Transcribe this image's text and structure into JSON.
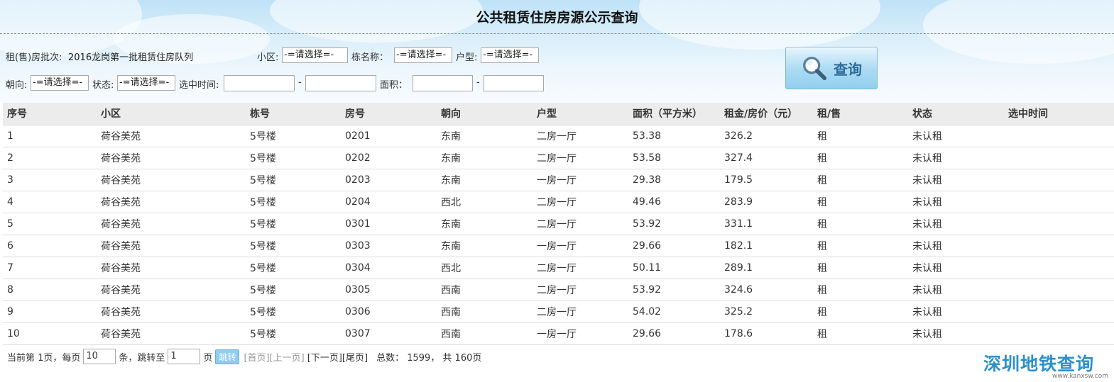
{
  "page": {
    "title": "公共租赁住房房源公示查询"
  },
  "filters": {
    "batch_label": "租(售)房批次:",
    "batch_value": "2016龙岗第一批租赁住房队列",
    "community_label": "小区:",
    "community_value": "-=请选择=-",
    "building_label": "栋名称：",
    "building_value": "-=请选择=-",
    "layout_label": "户型:",
    "layout_value": "-=请选择=-",
    "orientation_label": "朝向:",
    "orientation_value": "-=请选择=-",
    "status_label": "状态:",
    "status_value": "-=请选择=-",
    "selected_time_label": "选中时间:",
    "area_label": "面积：",
    "range_sep": "-"
  },
  "search_button": {
    "label": "查询"
  },
  "table": {
    "headers": [
      "序号",
      "小区",
      "栋号",
      "房号",
      "朝向",
      "户型",
      "面积（平方米）",
      "租金/房价（元）",
      "租/售",
      "状态",
      "选中时间"
    ],
    "rows": [
      [
        "1",
        "荷谷美苑",
        "5号楼",
        "0201",
        "东南",
        "二房一厅",
        "53.38",
        "326.2",
        "租",
        "未认租",
        ""
      ],
      [
        "2",
        "荷谷美苑",
        "5号楼",
        "0202",
        "东南",
        "二房一厅",
        "53.58",
        "327.4",
        "租",
        "未认租",
        ""
      ],
      [
        "3",
        "荷谷美苑",
        "5号楼",
        "0203",
        "东南",
        "一房一厅",
        "29.38",
        "179.5",
        "租",
        "未认租",
        ""
      ],
      [
        "4",
        "荷谷美苑",
        "5号楼",
        "0204",
        "西北",
        "二房一厅",
        "49.46",
        "283.9",
        "租",
        "未认租",
        ""
      ],
      [
        "5",
        "荷谷美苑",
        "5号楼",
        "0301",
        "东南",
        "二房一厅",
        "53.92",
        "331.1",
        "租",
        "未认租",
        ""
      ],
      [
        "6",
        "荷谷美苑",
        "5号楼",
        "0303",
        "东南",
        "一房一厅",
        "29.66",
        "182.1",
        "租",
        "未认租",
        ""
      ],
      [
        "7",
        "荷谷美苑",
        "5号楼",
        "0304",
        "西北",
        "二房一厅",
        "50.11",
        "289.1",
        "租",
        "未认租",
        ""
      ],
      [
        "8",
        "荷谷美苑",
        "5号楼",
        "0305",
        "西南",
        "二房一厅",
        "53.92",
        "324.6",
        "租",
        "未认租",
        ""
      ],
      [
        "9",
        "荷谷美苑",
        "5号楼",
        "0306",
        "西南",
        "二房一厅",
        "54.02",
        "325.2",
        "租",
        "未认租",
        ""
      ],
      [
        "10",
        "荷谷美苑",
        "5号楼",
        "0307",
        "西南",
        "一房一厅",
        "29.66",
        "178.6",
        "租",
        "未认租",
        ""
      ]
    ]
  },
  "pager": {
    "current_page_text": "当前第 1页，每页",
    "page_size": "10",
    "per_page_suffix": "条，跳转至",
    "jump_page": "1",
    "page_unit": "页",
    "jump_button": "跳转",
    "first": "[首页]",
    "prev": "[上一页]",
    "next": "[下一页]",
    "last": "[尾页]",
    "total_text": "总数： 1599， 共 160页"
  },
  "watermark": {
    "text": "深圳地铁查询",
    "url": "www.kanxsw.com"
  },
  "colors": {
    "accent": "#2d6c97",
    "header_bg": "#d9eefa",
    "table_header_bg": "#ececec",
    "watermark": "#2b90c9"
  },
  "icons": {
    "search": "magnifier-icon"
  }
}
